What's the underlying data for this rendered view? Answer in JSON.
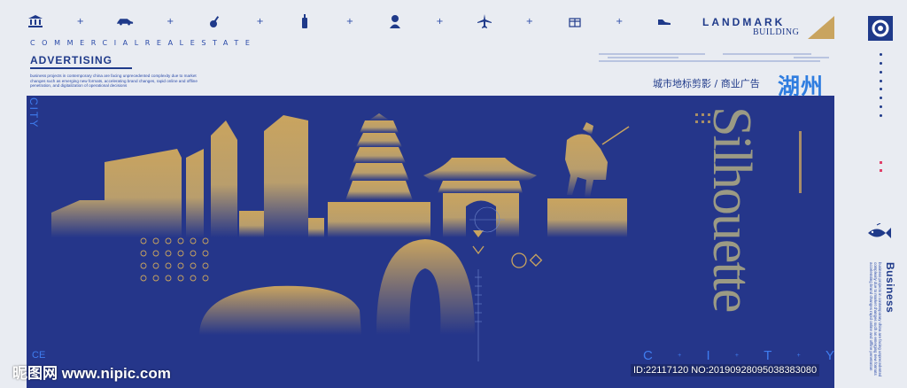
{
  "header": {
    "icons": [
      "bank-icon",
      "car-icon",
      "guitar-icon",
      "bottle-icon",
      "portrait-icon",
      "airplane-icon",
      "gift-icon",
      "sneaker-icon"
    ],
    "small_caps": "COMMERCIALREALESTATE",
    "advertising_title": "ADVERTISING",
    "advertising_body": "business projects in contemporary china are facing unprecedented complexity due to market changes such as emerging new formats, accelerating brand changes, rapid online and offline penetration, and digitalization of operational decisions",
    "landmark": "LANDMARK",
    "building": "BUILDING",
    "cn_subtitle": "城市地标剪影 / 商业广告",
    "cn_city": "湖州"
  },
  "panel": {
    "city_vertical": "CITY",
    "silhouette_word": "Silhouette",
    "city_bottom": [
      "C",
      "I",
      "T",
      "Y"
    ],
    "ce_text": "CE"
  },
  "sidebar": {
    "business_label": "Business",
    "business_body": "business projects in contemporary china are facing unprecedented complexity due to market changes such as emerging new formats accelerating brand changes rapid online and offline penetration"
  },
  "watermark": {
    "site": "www.nipic.com",
    "logo": "昵图网",
    "id_text": "ID:22117120 NO:20190928095038383080"
  },
  "colors": {
    "background": "#e9ecf2",
    "panel_blue": "#25368a",
    "gold": "#c9a45f",
    "accent_blue": "#3f7df0",
    "cn_title_blue": "#2f7de0"
  }
}
